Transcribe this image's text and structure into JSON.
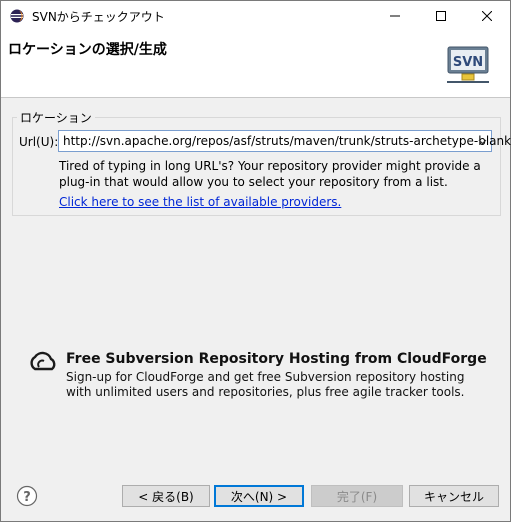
{
  "window": {
    "title": "SVNからチェックアウト",
    "app_icon": "eclipse-icon",
    "controls": {
      "minimize": "minimize-icon",
      "maximize": "maximize-icon",
      "close": "close-icon"
    }
  },
  "banner": {
    "title": "ロケーションの選択/生成",
    "logo_text": "SVN"
  },
  "location": {
    "group_label": "ロケーション",
    "url_label": "Url(U):",
    "url_value": "http://svn.apache.org/repos/asf/struts/maven/trunk/struts-archetype-blank",
    "hint": "Tired of typing in long URL's?  Your repository provider might provide a plug-in that would allow you to select your repository from a list.",
    "providers_link": "Click here to see the list of available providers."
  },
  "cloudforge": {
    "title": "Free Subversion Repository Hosting from CloudForge",
    "description": "Sign-up for CloudForge and get free Subversion repository hosting with unlimited users and repositories, plus free agile tracker tools."
  },
  "footer": {
    "back": "< 戻る(B)",
    "next": "次へ(N) >",
    "finish": "完了(F)",
    "cancel": "キャンセル"
  },
  "colors": {
    "link": "#0026d6",
    "focus": "#0078d7"
  }
}
